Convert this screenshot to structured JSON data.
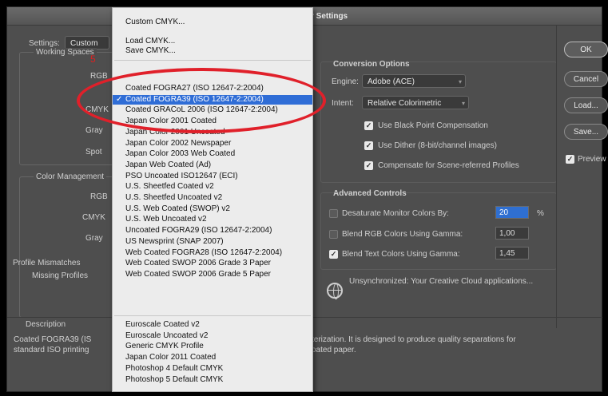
{
  "window": {
    "title_fragment": "r Settings"
  },
  "left": {
    "settings_label": "Settings:",
    "settings_value": "Custom",
    "working_spaces_header": "Working Spaces",
    "ws_rows": [
      {
        "label": "RGB"
      },
      {
        "label": "CMYK"
      },
      {
        "label": "Gray"
      },
      {
        "label": "Spot"
      }
    ],
    "color_mgmt_header": "Color Management",
    "cm_rows": [
      {
        "label": "RGB"
      },
      {
        "label": "CMYK"
      },
      {
        "label": "Gray"
      }
    ],
    "profile_mismatches": "Profile Mismatches",
    "missing_profiles": "Missing Profiles"
  },
  "cursor_mark": "5",
  "conversion": {
    "header": "Conversion Options",
    "engine_label": "Engine:",
    "engine_value": "Adobe (ACE)",
    "intent_label": "Intent:",
    "intent_value": "Relative Colorimetric",
    "black_point": "Use Black Point Compensation",
    "dither": "Use Dither (8-bit/channel images)",
    "scene_ref": "Compensate for Scene-referred Profiles"
  },
  "advanced": {
    "header": "Advanced Controls",
    "desaturate_label": "Desaturate Monitor Colors By:",
    "desaturate_value": "20",
    "desaturate_unit": "%",
    "blend_rgb_label": "Blend RGB Colors Using Gamma:",
    "blend_rgb_value": "1,00",
    "blend_text_label": "Blend Text Colors Using Gamma:",
    "blend_text_value": "1,45"
  },
  "sync_message": "Unsynchronized: Your Creative Cloud applications...",
  "buttons": {
    "ok": "OK",
    "cancel": "Cancel",
    "load": "Load...",
    "save": "Save..."
  },
  "preview_label": "Preview",
  "description": {
    "header": "Description",
    "line1_left": "Coated FOGRA39 (IS",
    "line2_left": "standard ISO printing",
    "line1_right": "cterization. It is designed to produce quality separations for",
    "line2_right": "coated paper."
  },
  "menu": {
    "top_items": [
      "Custom CMYK...",
      "Load CMYK...",
      "Save CMYK..."
    ],
    "profiles": [
      "Coated FOGRA27 (ISO 12647-2:2004)",
      "Coated FOGRA39 (ISO 12647-2:2004)",
      "Coated GRACoL 2006 (ISO 12647-2:2004)",
      "Japan Color 2001 Coated",
      "Japan Color 2001 Uncoated",
      "Japan Color 2002 Newspaper",
      "Japan Color 2003 Web Coated",
      "Japan Web Coated (Ad)",
      "PSO Uncoated ISO12647 (ECI)",
      "U.S. Sheetfed Coated v2",
      "U.S. Sheetfed Uncoated v2",
      "U.S. Web Coated (SWOP) v2",
      "U.S. Web Uncoated v2",
      "Uncoated FOGRA29 (ISO 12647-2:2004)",
      "US Newsprint (SNAP 2007)",
      "Web Coated FOGRA28 (ISO 12647-2:2004)",
      "Web Coated SWOP 2006 Grade 3 Paper",
      "Web Coated SWOP 2006 Grade 5 Paper"
    ],
    "other_profiles": [
      "Euroscale Coated v2",
      "Euroscale Uncoated v2",
      "Generic CMYK Profile",
      "Japan Color 2011 Coated",
      "Photoshop 4 Default CMYK",
      "Photoshop 5 Default CMYK"
    ],
    "selected_index": 1,
    "checkmark": "✓"
  },
  "colors": {
    "annotation": "#e0202a",
    "selection": "#2f6dd6"
  }
}
